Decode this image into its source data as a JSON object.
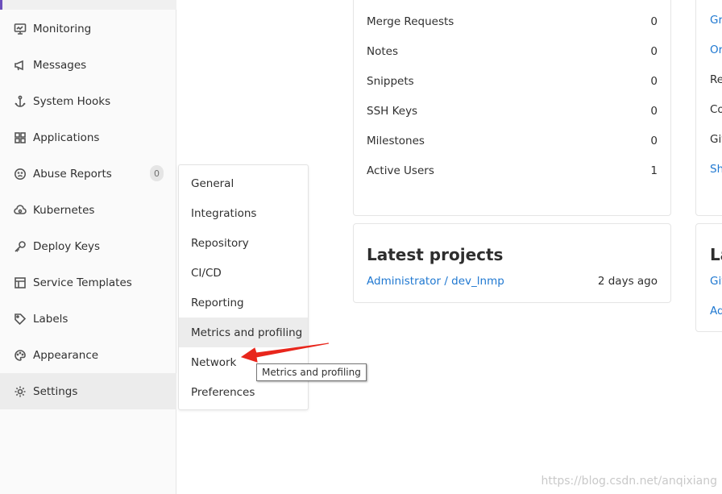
{
  "sidebar": {
    "items": [
      {
        "label": "Monitoring",
        "icon": "monitor-icon"
      },
      {
        "label": "Messages",
        "icon": "megaphone-icon"
      },
      {
        "label": "System Hooks",
        "icon": "hook-icon"
      },
      {
        "label": "Applications",
        "icon": "grid-icon"
      },
      {
        "label": "Abuse Reports",
        "icon": "sad-face-icon",
        "badge": "0"
      },
      {
        "label": "Kubernetes",
        "icon": "cloud-gear-icon"
      },
      {
        "label": "Deploy Keys",
        "icon": "key-icon"
      },
      {
        "label": "Service Templates",
        "icon": "template-icon"
      },
      {
        "label": "Labels",
        "icon": "tag-icon"
      },
      {
        "label": "Appearance",
        "icon": "palette-icon"
      },
      {
        "label": "Settings",
        "icon": "gear-icon"
      }
    ]
  },
  "settings_menu": {
    "items": [
      "General",
      "Integrations",
      "Repository",
      "CI/CD",
      "Reporting",
      "Metrics and profiling",
      "Network",
      "Preferences"
    ],
    "hovered": "Metrics and profiling"
  },
  "tooltip": "Metrics and profiling",
  "stats": [
    {
      "label": "Merge Requests",
      "value": "0"
    },
    {
      "label": "Notes",
      "value": "0"
    },
    {
      "label": "Snippets",
      "value": "0"
    },
    {
      "label": "SSH Keys",
      "value": "0"
    },
    {
      "label": "Milestones",
      "value": "0"
    },
    {
      "label": "Active Users",
      "value": "1"
    }
  ],
  "latest_projects": {
    "title": "Latest projects",
    "project": "Administrator / dev_lnmp",
    "time": "2 days ago"
  },
  "right_column": {
    "top_items": [
      "Gr",
      "Or",
      "Re",
      "Co",
      "Git",
      "Sh"
    ],
    "latest_title": "La",
    "bottom_items": [
      "Git",
      "Ad"
    ]
  },
  "watermark": "https://blog.csdn.net/anqixiang",
  "colors": {
    "accent": "#6b4fbb",
    "link": "#1f78d1",
    "arrow": "#e8261c"
  }
}
